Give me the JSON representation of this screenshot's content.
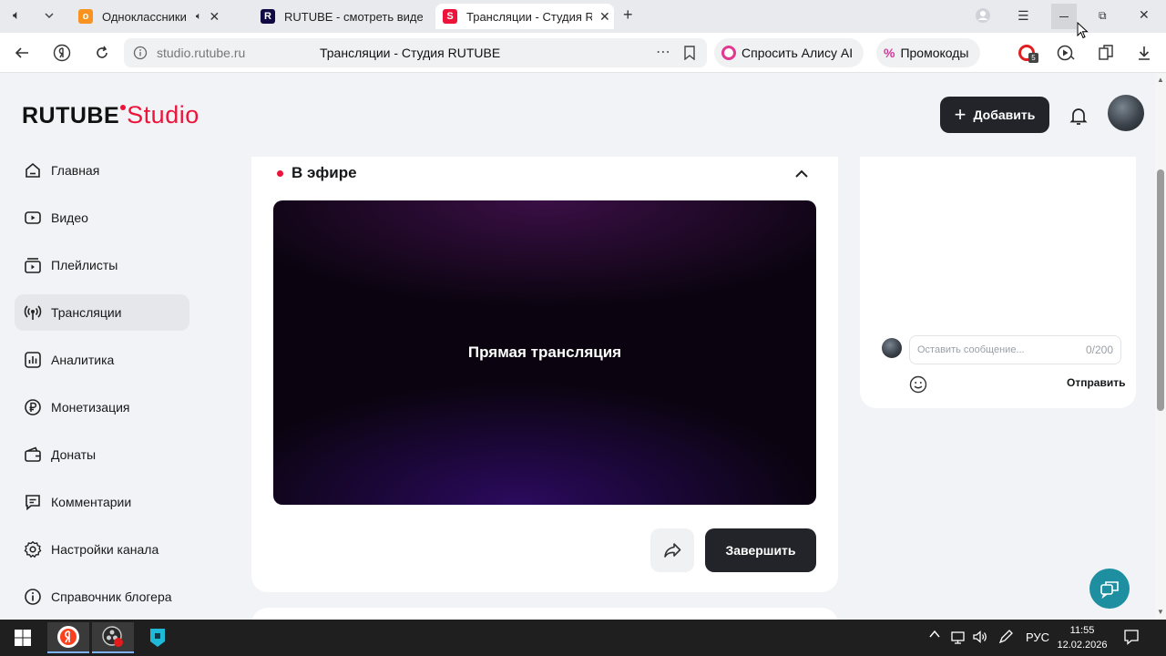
{
  "browser": {
    "tabs": [
      {
        "title": "Одноклассники",
        "active": false
      },
      {
        "title": "RUTUBE - смотреть виде",
        "active": false
      },
      {
        "title": "Трансляции - Студия R",
        "active": true
      }
    ],
    "address": {
      "host": "studio.rutube.ru",
      "page_title": "Трансляции - Студия RUTUBE"
    },
    "alice_label": "Спросить Алису AI",
    "promo_label": "Промокоды",
    "badge_count": "5"
  },
  "header": {
    "logo_main": "RUTUBE",
    "logo_studio": "Studio",
    "add_label": "Добавить"
  },
  "sidebar": {
    "items": [
      {
        "label": "Главная",
        "icon": "home-icon"
      },
      {
        "label": "Видео",
        "icon": "video-icon"
      },
      {
        "label": "Плейлисты",
        "icon": "playlist-icon"
      },
      {
        "label": "Трансляции",
        "icon": "broadcast-icon",
        "active": true
      },
      {
        "label": "Аналитика",
        "icon": "analytics-icon"
      },
      {
        "label": "Монетизация",
        "icon": "ruble-icon"
      },
      {
        "label": "Донаты",
        "icon": "wallet-icon"
      },
      {
        "label": "Комментарии",
        "icon": "comment-icon"
      },
      {
        "label": "Настройки канала",
        "icon": "gear-icon"
      },
      {
        "label": "Справочник блогера",
        "icon": "info-icon"
      }
    ]
  },
  "stream": {
    "status": "В эфире",
    "player_text": "Прямая трансляция",
    "end_label": "Завершить"
  },
  "chat": {
    "placeholder": "Оставить сообщение...",
    "counter": "0/200",
    "send_label": "Отправить"
  },
  "taskbar": {
    "lang": "РУС",
    "time": "11:55",
    "date": "12.02.2026"
  },
  "colors": {
    "brand": "#ed143b",
    "dark_button": "#222429",
    "help": "#1d8fa0"
  }
}
